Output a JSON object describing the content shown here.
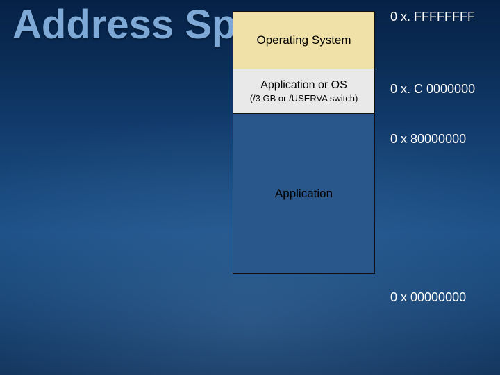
{
  "title": "Address Space",
  "regions": {
    "os": {
      "label": "Operating System"
    },
    "switch": {
      "label": "Application or OS",
      "sublabel": "(/3 GB or /USERVA switch)"
    },
    "app": {
      "label": "Application"
    }
  },
  "addresses": {
    "top": "0 x. FFFFFFFF",
    "c0": "0 x. C 0000000",
    "mid": "0 x 80000000",
    "bottom": "0 x 00000000"
  }
}
